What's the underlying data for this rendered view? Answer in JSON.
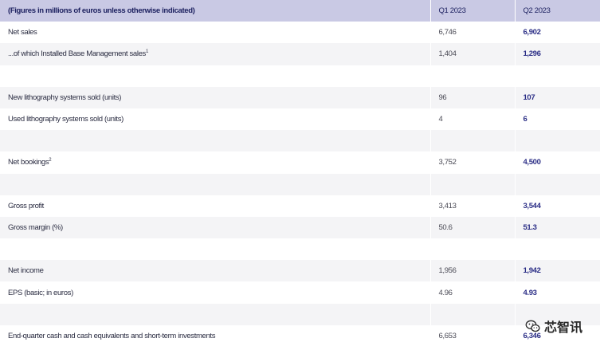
{
  "header": {
    "caption": "(Figures in millions of euros unless otherwise indicated)",
    "col_q1": "Q1 2023",
    "col_q2": "Q2 2023"
  },
  "rows": [
    {
      "label": "Net sales",
      "note": "",
      "q1": "6,746",
      "q2": "6,902"
    },
    {
      "label": "...of which Installed Base Management sales",
      "note": "1",
      "q1": "1,404",
      "q2": "1,296"
    },
    {
      "label": "",
      "note": "",
      "q1": "",
      "q2": ""
    },
    {
      "label": "New lithography systems sold (units)",
      "note": "",
      "q1": "96",
      "q2": "107"
    },
    {
      "label": "Used lithography systems sold (units)",
      "note": "",
      "q1": "4",
      "q2": "6"
    },
    {
      "label": "",
      "note": "",
      "q1": "",
      "q2": ""
    },
    {
      "label": "Net bookings",
      "note": "2",
      "q1": "3,752",
      "q2": "4,500"
    },
    {
      "label": "",
      "note": "",
      "q1": "",
      "q2": ""
    },
    {
      "label": "Gross profit",
      "note": "",
      "q1": "3,413",
      "q2": "3,544"
    },
    {
      "label": "Gross margin (%)",
      "note": "",
      "q1": "50.6",
      "q2": "51.3"
    },
    {
      "label": "",
      "note": "",
      "q1": "",
      "q2": ""
    },
    {
      "label": "Net income",
      "note": "",
      "q1": "1,956",
      "q2": "1,942"
    },
    {
      "label": "EPS (basic; in euros)",
      "note": "",
      "q1": "4.96",
      "q2": "4.93"
    },
    {
      "label": "",
      "note": "",
      "q1": "",
      "q2": ""
    },
    {
      "label": "End-quarter cash and cash equivalents and short-term investments",
      "note": "",
      "q1": "6,653",
      "q2": "6,346"
    }
  ],
  "watermark": {
    "text": "芯智讯",
    "icon": "wechat-icon"
  },
  "colors": {
    "header_bg": "#c9c9e4",
    "row_alt_bg": "#f4f4f6",
    "accent": "#2b2e86"
  }
}
